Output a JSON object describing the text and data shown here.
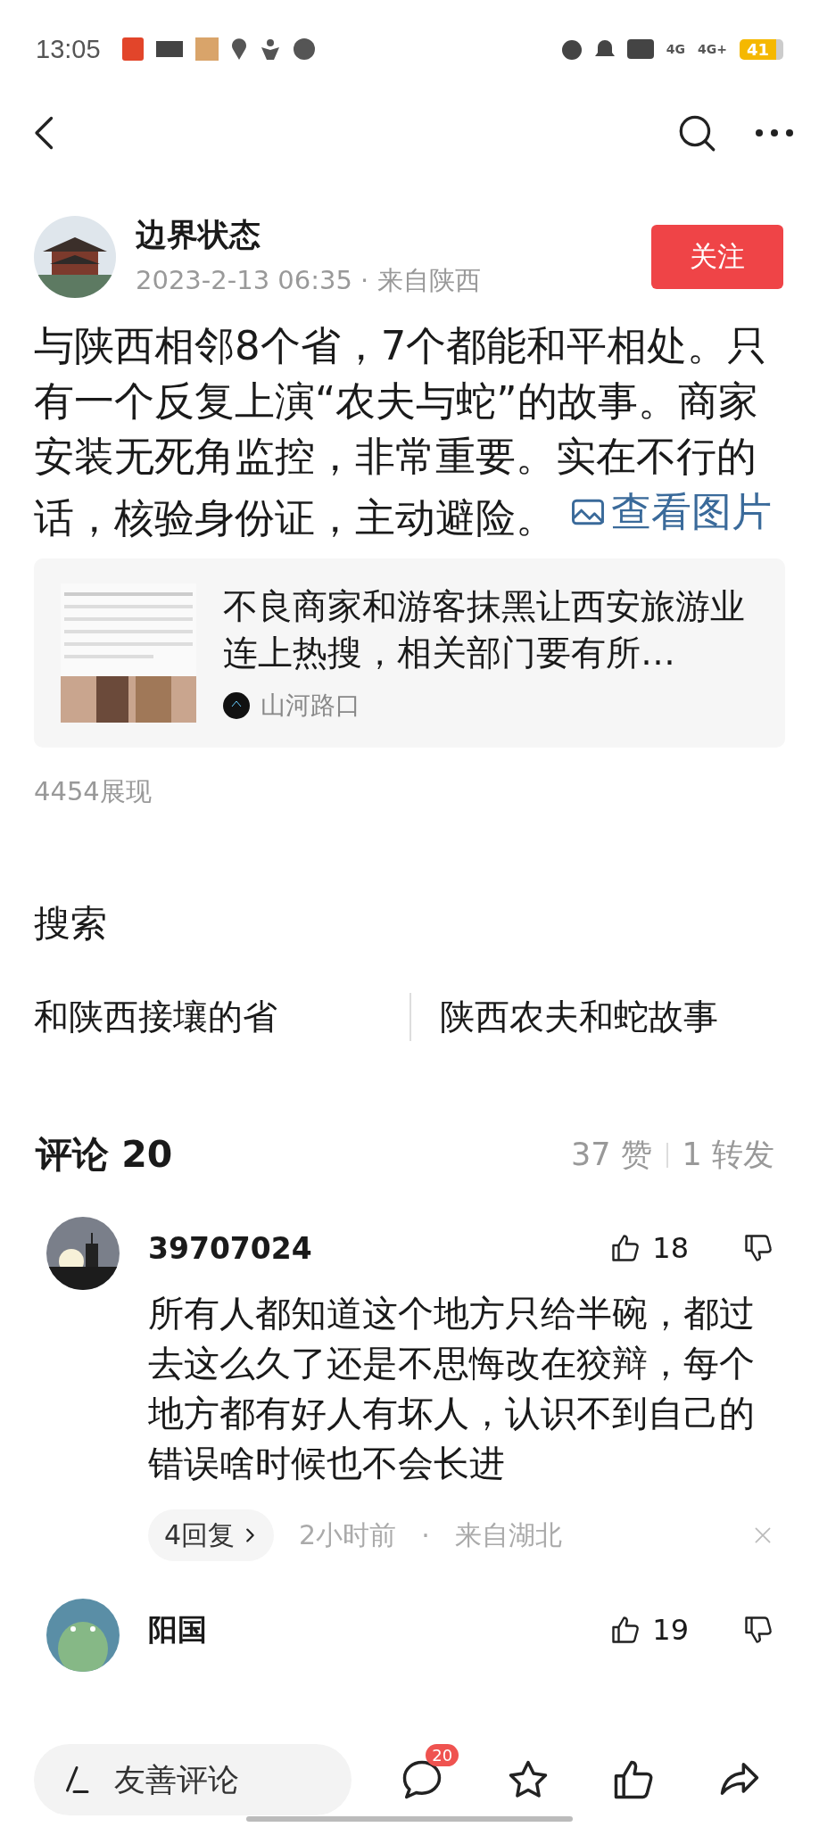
{
  "status_bar": {
    "time": "13:05",
    "network_1": "4G",
    "network_2": "4G+",
    "battery": "41"
  },
  "post": {
    "author": "边界状态",
    "meta": "2023-2-13 06:35 · 来自陕西",
    "follow": "关注",
    "body": "与陕西相邻8个省，7个都能和平相处。只有一个反复上演“农夫与蛇”的故事。商家安装无死角监控，非常重要。实在不行的话，核验身份证，主动避险。",
    "view_images": "查看图片",
    "card": {
      "title": "不良商家和游客抹黑让西安旅游业连上热搜，相关部门要有所…",
      "source": "山河路口"
    },
    "views": "4454展现"
  },
  "search": {
    "title": "搜索",
    "suggestions": [
      "和陕西接壤的省",
      "陕西农夫和蛇故事"
    ]
  },
  "comments_header": {
    "title": "评论 20",
    "likes": "37 赞",
    "reposts": "1 转发"
  },
  "comments": [
    {
      "user": "39707024",
      "likes": "18",
      "text": "所有人都知道这个地方只给半碗，都过去这么久了还是不思悔改在狡辩，每个地方都有好人有坏人，认识不到自己的错误啥时候也不会长进",
      "replies": "4回复",
      "time": "2小时前",
      "separator": "·",
      "location": "来自湖北"
    },
    {
      "user": "阳国",
      "likes": "19"
    }
  ],
  "bottom_bar": {
    "placeholder": "友善评论",
    "comment_count": "20"
  }
}
